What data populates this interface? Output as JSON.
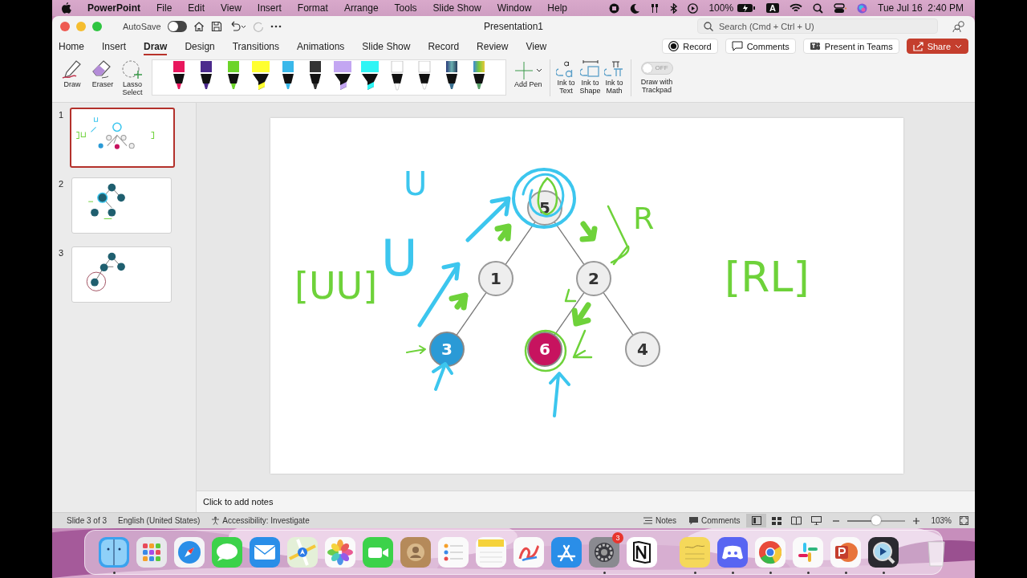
{
  "menu_bar": {
    "app": "PowerPoint",
    "items": [
      "File",
      "Edit",
      "View",
      "Insert",
      "Format",
      "Arrange",
      "Tools",
      "Slide Show",
      "Window",
      "Help"
    ],
    "battery": "100%",
    "input_source": "A",
    "clock": "Tue Jul 16  2:40 PM"
  },
  "window": {
    "title": "Presentation1",
    "autosave": {
      "label": "AutoSave",
      "on": false
    },
    "search": {
      "placeholder": "Search (Cmd + Ctrl + U)"
    }
  },
  "tabs": [
    {
      "label": "Home",
      "selected": false
    },
    {
      "label": "Insert",
      "selected": false
    },
    {
      "label": "Draw",
      "selected": true
    },
    {
      "label": "Design",
      "selected": false
    },
    {
      "label": "Transitions",
      "selected": false
    },
    {
      "label": "Animations",
      "selected": false
    },
    {
      "label": "Slide Show",
      "selected": false
    },
    {
      "label": "Record",
      "selected": false
    },
    {
      "label": "Review",
      "selected": false
    },
    {
      "label": "View",
      "selected": false
    }
  ],
  "actions": [
    {
      "label": "Record",
      "kind": "record"
    },
    {
      "label": "Comments",
      "kind": "comments"
    },
    {
      "label": "Present in Teams",
      "kind": "teams"
    },
    {
      "label": "Share",
      "kind": "share"
    }
  ],
  "ribbon": {
    "tools": [
      {
        "label": "Draw",
        "kind": "draw"
      },
      {
        "label": "Eraser",
        "kind": "eraser"
      },
      {
        "label": "Lasso Select",
        "kind": "lasso"
      }
    ],
    "pens": [
      {
        "kind": "pen",
        "color": "#e8175d"
      },
      {
        "kind": "pen",
        "color": "#4b2a8c"
      },
      {
        "kind": "pen",
        "color": "#6cd42a"
      },
      {
        "kind": "highlighter",
        "color": "#ffff30"
      },
      {
        "kind": "pen",
        "color": "#3ab8ea"
      },
      {
        "kind": "pen",
        "color": "#333333"
      },
      {
        "kind": "highlighter",
        "color": "#c3a6f2"
      },
      {
        "kind": "highlighter",
        "color": "#30f5f5"
      },
      {
        "kind": "pencil",
        "color": "#ffffff"
      },
      {
        "kind": "pen",
        "color": "#ffffff"
      },
      {
        "kind": "galaxy",
        "color": "#3a6f8f"
      },
      {
        "kind": "rainbow",
        "color": "#5aa06a"
      }
    ],
    "add_pen": "Add Pen",
    "ink_tools": [
      {
        "label": "Ink to Text",
        "kind": "text"
      },
      {
        "label": "Ink to Shape",
        "kind": "shape"
      },
      {
        "label": "Ink to Math",
        "kind": "math"
      }
    ],
    "trackpad": {
      "state": "OFF",
      "on": false,
      "label": "Draw with Trackpad"
    }
  },
  "slides": [
    {
      "number": "1",
      "selected": true
    },
    {
      "number": "2",
      "selected": false
    },
    {
      "number": "3",
      "selected": false
    }
  ],
  "slide": {
    "tree": {
      "label": "5",
      "color": "#eeeeee",
      "children": [
        {
          "label": "1",
          "color": "#eeeeee",
          "children": [
            {
              "label": "3",
              "color": "#2a9ad6"
            }
          ]
        },
        {
          "label": "2",
          "color": "#eeeeee",
          "children": [
            {
              "label": "6",
              "color": "#c7135f"
            },
            {
              "label": "4",
              "color": "#eeeeee"
            }
          ]
        }
      ]
    },
    "ink_texts": [
      {
        "text": "U",
        "color": "#3cc6ee"
      },
      {
        "text": "[UU]",
        "color": "#6ed23a"
      },
      {
        "text": "U",
        "color": "#3cc6ee"
      },
      {
        "text": "R",
        "color": "#6ed23a"
      },
      {
        "text": "[RL]",
        "color": "#6ed23a"
      }
    ]
  },
  "notes": {
    "placeholder": "Click to add notes"
  },
  "status_bar": {
    "slide": "Slide 3 of 3",
    "language": "English (United States)",
    "accessibility": "Accessibility: Investigate",
    "notes": "Notes",
    "comments": "Comments",
    "views": [
      {
        "kind": "normal",
        "selected": true
      },
      {
        "kind": "sorter",
        "selected": false
      },
      {
        "kind": "reading",
        "selected": false
      },
      {
        "kind": "slideshow",
        "selected": false
      }
    ],
    "zoom": {
      "level": 0.5,
      "reading": "103%"
    }
  },
  "dock": {
    "apps": [
      {
        "running": true
      },
      {
        "running": false
      },
      {
        "running": false
      },
      {
        "running": false
      },
      {
        "running": false
      },
      {
        "running": false
      },
      {
        "running": false
      },
      {
        "running": false
      },
      {
        "running": false
      },
      {
        "running": false
      },
      {
        "running": false
      },
      {
        "running": false
      },
      {
        "running": false
      },
      {
        "badge": "3",
        "running": true
      },
      {
        "running": false
      },
      {
        "running": true
      },
      {
        "running": true
      },
      {
        "running": true
      },
      {
        "running": true
      },
      {
        "running": true
      },
      {
        "running": true
      }
    ]
  }
}
